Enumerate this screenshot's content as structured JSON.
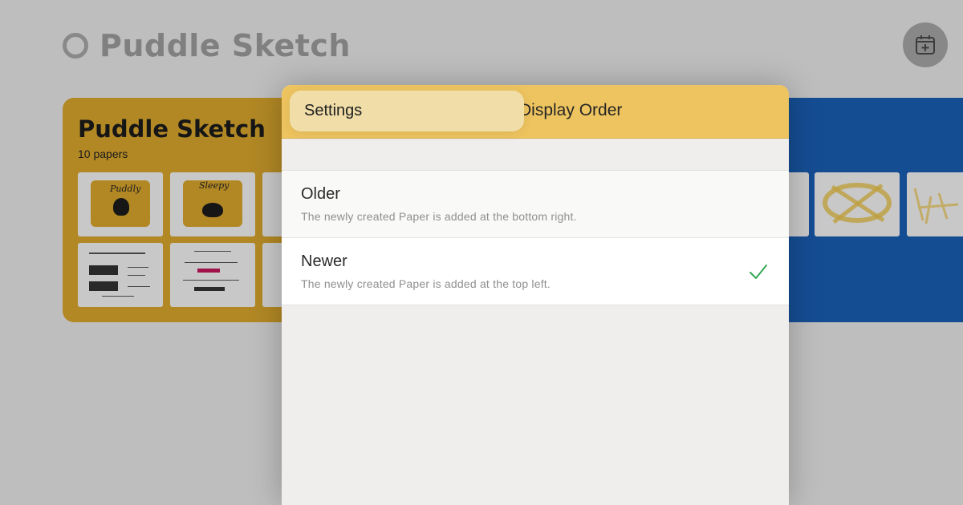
{
  "background": {
    "app_title": "Puddle Sketch",
    "folders": [
      {
        "name": "Puddle Sketch",
        "count_label": "10 papers",
        "color": "#d9a62e"
      },
      {
        "color": "#1a5fb4"
      }
    ],
    "thumb_texts": [
      "Puddly",
      "Sleepy"
    ]
  },
  "sheet": {
    "back_label": "Settings",
    "title": "Display Order",
    "options": [
      {
        "label": "Older",
        "description": "The newly created Paper is added at the bottom right.",
        "selected": false
      },
      {
        "label": "Newer",
        "description": "The newly created Paper is added at the top left.",
        "selected": true
      }
    ],
    "accent_color": "#edc45f",
    "check_color": "#34a853"
  },
  "icons": {
    "calendar_add": "calendar-plus-icon",
    "checkmark": "checkmark-icon",
    "logo": "ring-logo-icon"
  }
}
